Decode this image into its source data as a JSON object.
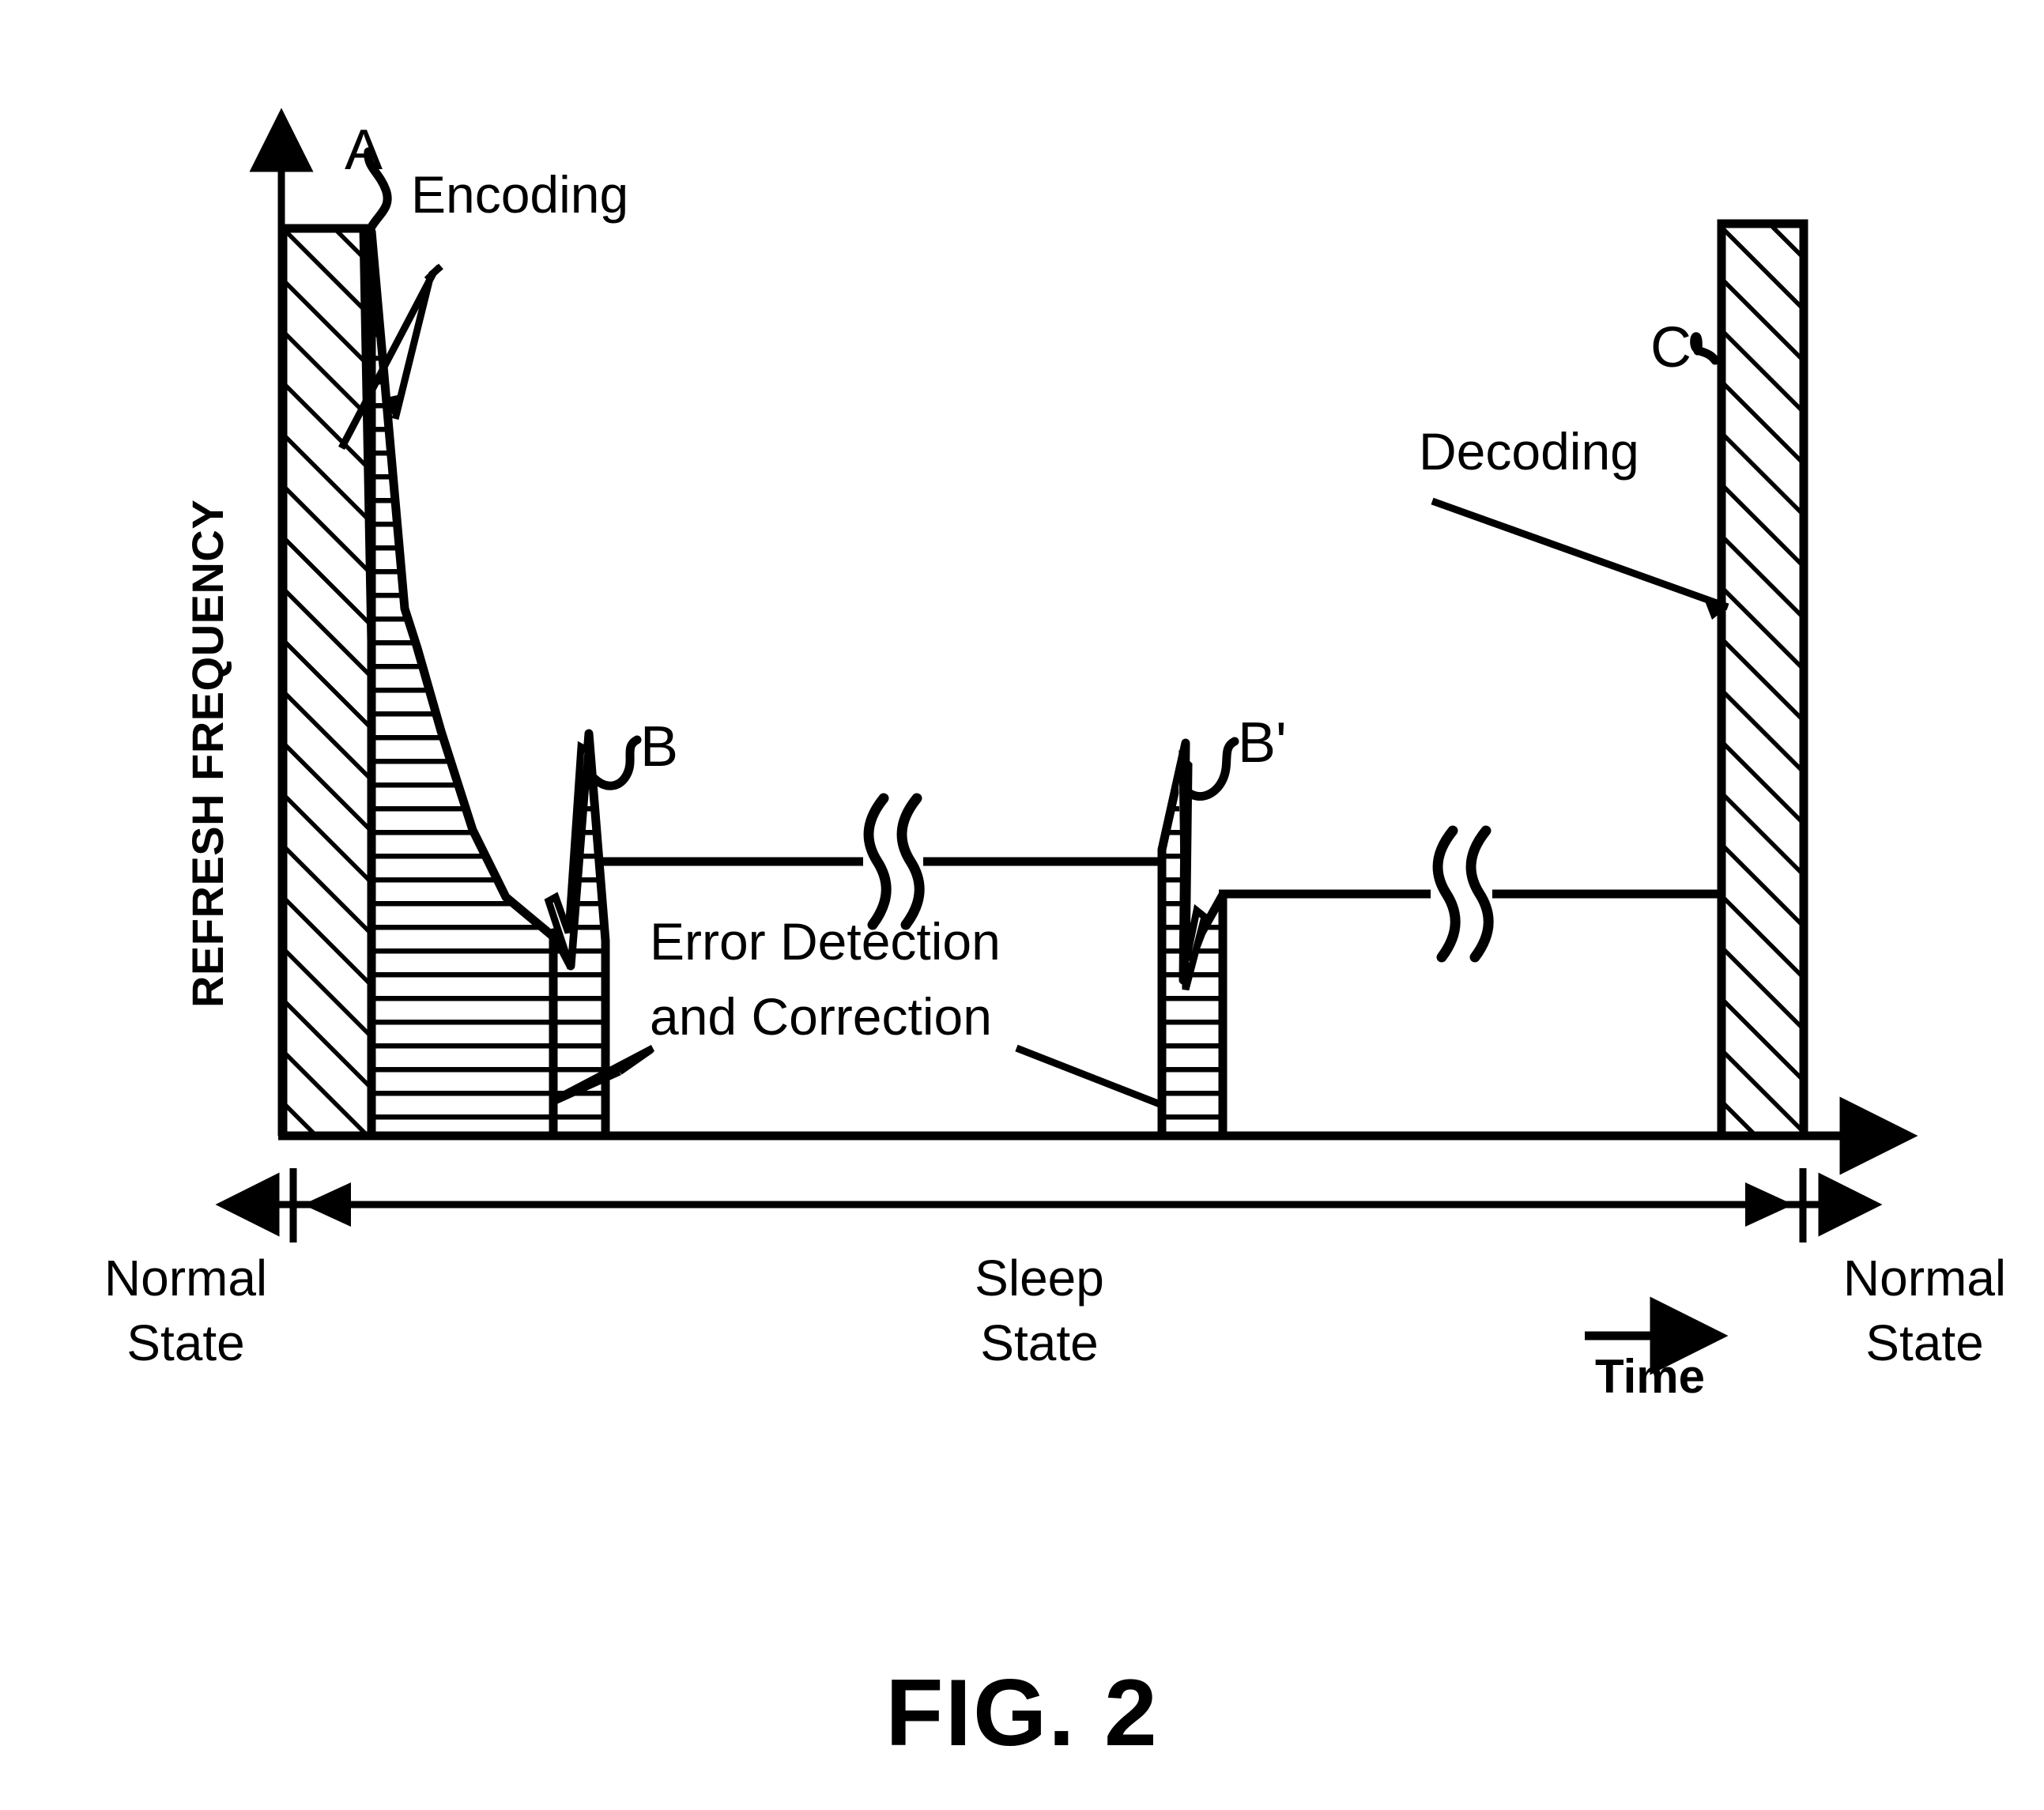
{
  "figure": {
    "caption": "FIG. 2",
    "axis": {
      "y_label": "REFRESH FREQUENCY",
      "x_label": "Time"
    },
    "callouts": {
      "encoding": "Encoding",
      "decoding": "Decoding",
      "error_correction_line1": "Error Detection",
      "error_correction_line2": "and Correction"
    },
    "markers": {
      "a": "A",
      "b": "B",
      "b_prime": "B'",
      "c": "C"
    },
    "states": {
      "left_line1": "Normal",
      "left_line2": "State",
      "middle_line1": "Sleep",
      "middle_line2": "State",
      "right_line1": "Normal",
      "right_line2": "State"
    },
    "colors": {
      "ink": "#000000",
      "paper": "#ffffff"
    }
  },
  "chart_data": {
    "type": "area",
    "title": "FIG. 2",
    "xlabel": "Time",
    "ylabel": "REFRESH FREQUENCY",
    "grid": false,
    "legend": "none",
    "x_axis_range_note": "Time axis, unlabeled ticks; three phases: Normal State, Sleep State, Normal State",
    "phases": [
      {
        "name": "Normal State",
        "position": "left"
      },
      {
        "name": "Sleep State",
        "position": "middle"
      },
      {
        "name": "Normal State",
        "position": "right"
      }
    ],
    "regions": [
      {
        "id": "A",
        "label": "Encoding",
        "hatch": "diagonal",
        "description": "Full-height bar at maximum refresh frequency during encoding at start of sleep transition",
        "value_relative": 1.0
      },
      {
        "id": "error-detection-left",
        "label": "Error Detection and Correction",
        "hatch": "horizontal",
        "description": "Refresh frequency decays from maximum down toward the low sleep-state level, then a narrow spike B",
        "value_relative_start": 0.96,
        "value_relative_end": 0.12
      },
      {
        "id": "B",
        "label": "B",
        "hatch": "horizontal",
        "description": "Narrow refresh spike before entering steady low sleep refresh level",
        "value_relative": 0.52
      },
      {
        "id": "sleep-plateau-1",
        "label": "",
        "hatch": "none",
        "description": "Steady low refresh level during sleep state, drawn with a break mark",
        "value_relative": 0.37
      },
      {
        "id": "B-prime",
        "label": "B'",
        "hatch": "horizontal",
        "description": "Second narrow refresh spike during sleep state, followed by a slightly lower plateau",
        "value_relative": 0.52
      },
      {
        "id": "sleep-plateau-2",
        "label": "",
        "hatch": "none",
        "description": "Second steady low refresh level during sleep state, drawn with a break mark",
        "value_relative": 0.34
      },
      {
        "id": "C",
        "label": "Decoding",
        "hatch": "diagonal",
        "description": "Full-height bar at maximum refresh frequency during decoding when returning to normal state",
        "value_relative": 1.0
      }
    ],
    "annotations": [
      {
        "text": "A",
        "target": "encoding bar top"
      },
      {
        "text": "Encoding",
        "target": "descending hatched region"
      },
      {
        "text": "B",
        "target": "first refresh spike"
      },
      {
        "text": "Error Detection and Correction",
        "target": "baseline between B and B'"
      },
      {
        "text": "B'",
        "target": "second refresh spike"
      },
      {
        "text": "Decoding",
        "target": "C bar"
      },
      {
        "text": "C",
        "target": "decoding bar"
      },
      {
        "text": "Time",
        "target": "x-axis direction arrow"
      }
    ]
  }
}
